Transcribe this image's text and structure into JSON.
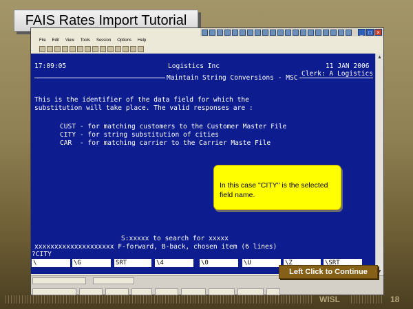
{
  "slide": {
    "title": "FAIS Rates Import Tutorial",
    "continue_label": "Left Click to Continue",
    "footer_brand": "WISL",
    "page_number": "18"
  },
  "window": {
    "menu": [
      "File",
      "Edit",
      "View",
      "Tools",
      "Session",
      "Options",
      "Help"
    ],
    "controls": {
      "minimize": "_",
      "maximize": "□",
      "close": "×"
    }
  },
  "terminal": {
    "time": "17:09:05",
    "company": "Logistics Inc",
    "date": "11 JAN 2006",
    "clerk": "Clerk: A Logistics",
    "screen_name": "Maintain String Conversions - MSC",
    "body_lines": [
      "This is the identifier of the data field for which the",
      "substitution will take place. The valid responses are :"
    ],
    "options": [
      "CUST - for matching customers to the Customer Master File",
      "CITY - for string substitution of cities",
      "CAR  - for matching carrier to the Carrier Maste File"
    ],
    "search_hint": "S:xxxxx to search for xxxxx",
    "nav_hint": "xxxxxxxxxxxxxxxxxxxx F-forward, B-back, chosen item (6 lines)",
    "prompt": "?CITY",
    "fkeys": [
      "\\",
      "\\G",
      "SRT",
      "\\4",
      "\\0",
      "\\U",
      "\\Z",
      "\\SRT"
    ]
  },
  "callout": {
    "text": "In this case \"CITY\" is the selected field name."
  }
}
